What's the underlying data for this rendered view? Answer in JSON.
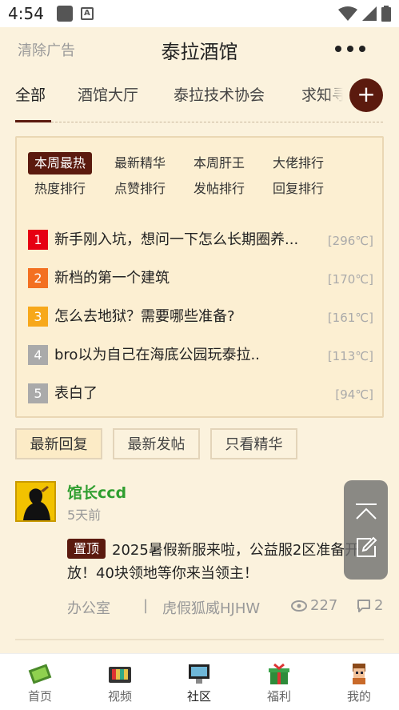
{
  "status_bar": {
    "time": "4:54"
  },
  "header": {
    "clear_ad": "清除广告",
    "title": "泰拉酒馆"
  },
  "tabs": [
    {
      "label": "全部"
    },
    {
      "label": "酒馆大厅"
    },
    {
      "label": "泰拉技术协会"
    },
    {
      "label": "求知寻"
    }
  ],
  "filters": [
    "本周最热",
    "最新精华",
    "本周肝王",
    "大佬排行",
    "热度排行",
    "点赞排行",
    "发帖排行",
    "回复排行"
  ],
  "rankings": [
    {
      "num": "1",
      "title": "新手刚入坑，想问一下怎么长期圈养...",
      "heat": "[296℃]",
      "color": "#e60012"
    },
    {
      "num": "2",
      "title": "新档的第一个建筑",
      "heat": "[170℃]",
      "color": "#f37021"
    },
    {
      "num": "3",
      "title": "怎么去地狱？需要哪些准备?",
      "heat": "[161℃]",
      "color": "#f7a81b"
    },
    {
      "num": "4",
      "title": "bro以为自己在海底公园玩泰拉..",
      "heat": "[113℃]",
      "color": "#aaaaaa"
    },
    {
      "num": "5",
      "title": "表白了",
      "heat": "[94℃]",
      "color": "#aaaaaa"
    }
  ],
  "sort_buttons": [
    "最新回复",
    "最新发帖",
    "只看精华"
  ],
  "post": {
    "author": "馆长ccd",
    "time": "5天前",
    "pin_label": "置顶",
    "text": "2025暑假新服来啦，公益服2区准备开放！40块领地等你来当领主！",
    "category": "办公室",
    "separator": "|",
    "last_reply_user": "虎假狐威HJHW",
    "views": "227",
    "comments": "2"
  },
  "bottom_nav": [
    {
      "label": "首页"
    },
    {
      "label": "视频"
    },
    {
      "label": "社区"
    },
    {
      "label": "福利"
    },
    {
      "label": "我的"
    }
  ],
  "colors": {
    "accent": "#5b1a0e",
    "background": "#fbf2dd",
    "author": "#2f9e2f"
  }
}
